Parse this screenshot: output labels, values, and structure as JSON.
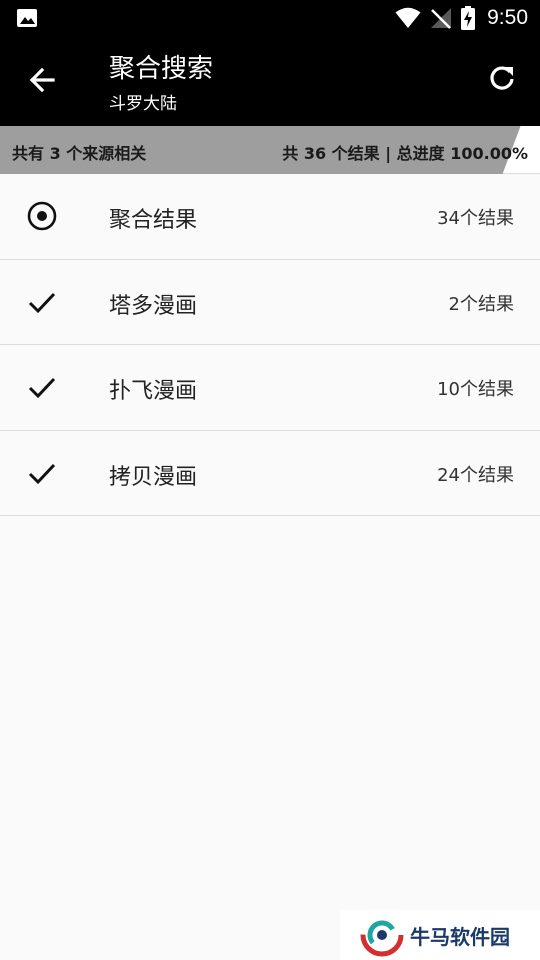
{
  "status_bar": {
    "time": "9:50",
    "icons": [
      "gallery-icon",
      "wifi-icon",
      "signal-off-icon",
      "battery-charging-icon"
    ]
  },
  "app_bar": {
    "title": "聚合搜索",
    "subtitle": "斗罗大陆",
    "back_icon": "arrow-left-icon",
    "refresh_icon": "refresh-icon"
  },
  "progress": {
    "sources_text": "共有 3 个来源相关",
    "summary_text": "共 36 个结果 | 总进度 100.00%",
    "fraction": 0.964
  },
  "results": [
    {
      "icon": "radio-selected-icon",
      "name": "聚合结果",
      "count": "34个结果"
    },
    {
      "icon": "check-icon",
      "name": "塔多漫画",
      "count": "2个结果"
    },
    {
      "icon": "check-icon",
      "name": "扑飞漫画",
      "count": "10个结果"
    },
    {
      "icon": "check-icon",
      "name": "拷贝漫画",
      "count": "24个结果"
    }
  ],
  "watermark": {
    "text": "牛马软件园"
  }
}
